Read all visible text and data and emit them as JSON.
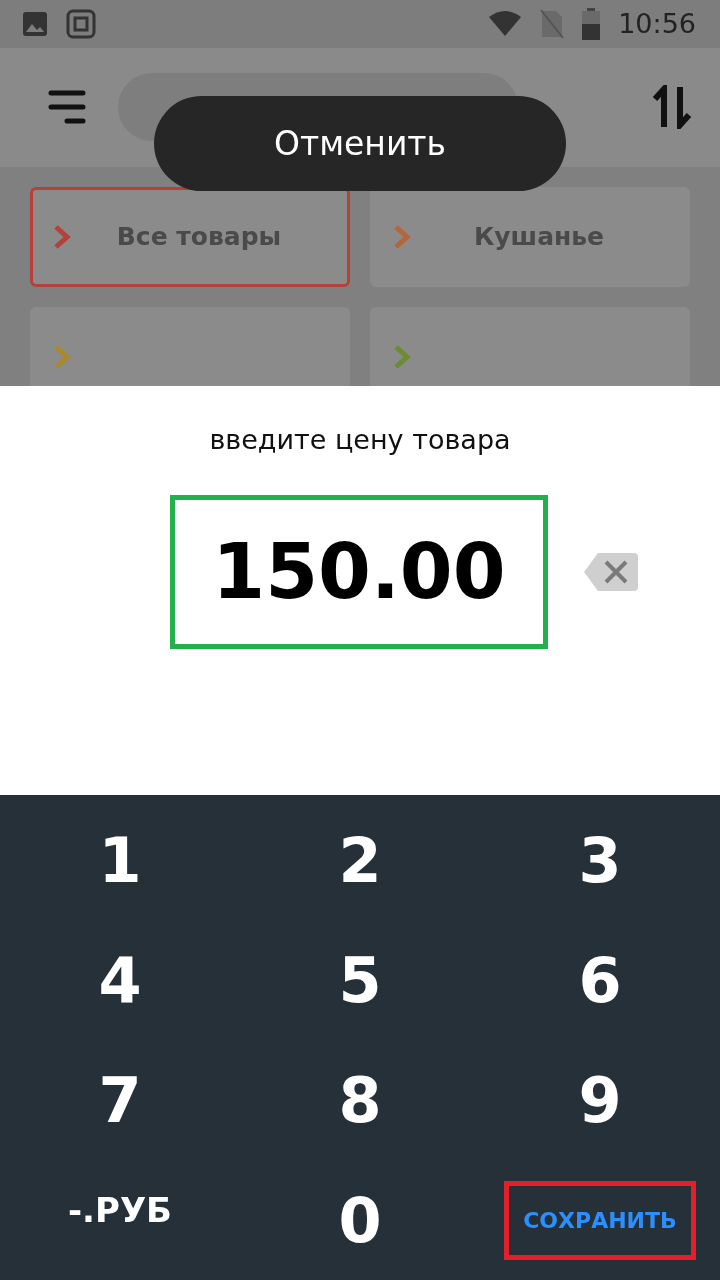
{
  "status_bar": {
    "time": "10:56"
  },
  "toast": {
    "label": "Отменить"
  },
  "categories": [
    {
      "label": "Все товары",
      "selected": true,
      "color": "#b5413b"
    },
    {
      "label": "Кушанье",
      "selected": false,
      "color": "#b5653a"
    },
    {
      "selected": false,
      "color": "#a88a2e"
    },
    {
      "selected": false,
      "color": "#6b8c32"
    }
  ],
  "dialog": {
    "prompt": "введите цену товара",
    "value": "150.00"
  },
  "keypad": [
    {
      "label": "1",
      "kind": "digit",
      "highlighted": false
    },
    {
      "label": "2",
      "kind": "digit",
      "highlighted": false
    },
    {
      "label": "3",
      "kind": "digit",
      "highlighted": false
    },
    {
      "label": "4",
      "kind": "digit",
      "highlighted": false
    },
    {
      "label": "5",
      "kind": "digit",
      "highlighted": false
    },
    {
      "label": "6",
      "kind": "digit",
      "highlighted": false
    },
    {
      "label": "7",
      "kind": "digit",
      "highlighted": false
    },
    {
      "label": "8",
      "kind": "digit",
      "highlighted": false
    },
    {
      "label": "9",
      "kind": "digit",
      "highlighted": false
    },
    {
      "label": "-.РУБ",
      "kind": "text",
      "highlighted": false
    },
    {
      "label": "0",
      "kind": "digit",
      "highlighted": false
    },
    {
      "label": "СОХРАНИТЬ",
      "kind": "action",
      "highlighted": true
    }
  ]
}
